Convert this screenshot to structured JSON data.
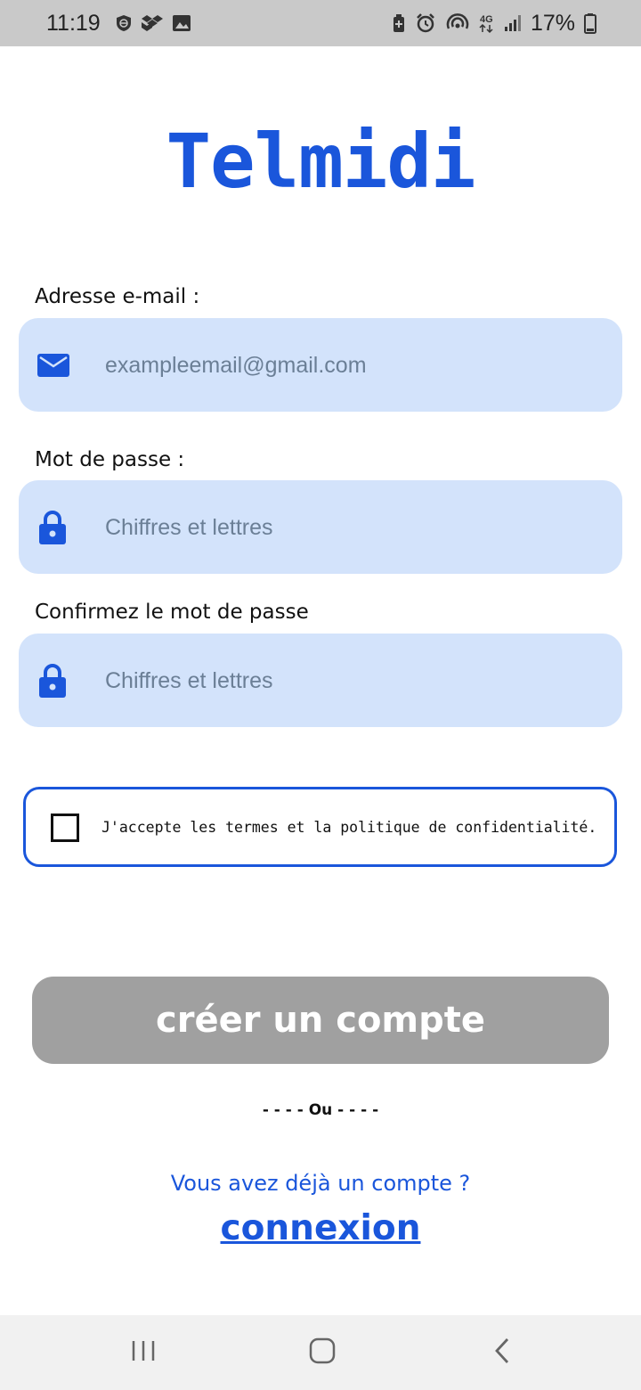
{
  "status_bar": {
    "time": "11:19",
    "battery": "17%",
    "icons_left": [
      "vpn-shield-icon",
      "dropbox-icon",
      "gallery-icon"
    ],
    "icons_right": [
      "battery-saver-icon",
      "alarm-icon",
      "hotspot-icon",
      "4g-icon",
      "signal-icon",
      "battery-icon"
    ],
    "network": "4G"
  },
  "app": {
    "logo": "Telmidi",
    "accent_color": "#1a56db"
  },
  "form": {
    "email": {
      "label": "Adresse e-mail :",
      "placeholder": "exampleemail@gmail.com",
      "value": "",
      "icon": "mail-icon"
    },
    "password": {
      "label": "Mot de passe :",
      "placeholder": "Chiffres et lettres",
      "value": "",
      "icon": "lock-icon"
    },
    "confirm_password": {
      "label": "Confirmez le mot de passe",
      "placeholder": "Chiffres et lettres",
      "value": "",
      "icon": "lock-icon"
    },
    "terms": {
      "label": "J'accepte les termes et la politique de confidentialité.",
      "checked": false
    },
    "submit_label": "créer un compte"
  },
  "separator": "- - - - Ou - - - -",
  "login": {
    "prompt": "Vous avez déjà un compte ?",
    "link_label": "connexion"
  },
  "nav_bar": {
    "items": [
      "recent-apps-icon",
      "home-icon",
      "back-icon"
    ]
  }
}
